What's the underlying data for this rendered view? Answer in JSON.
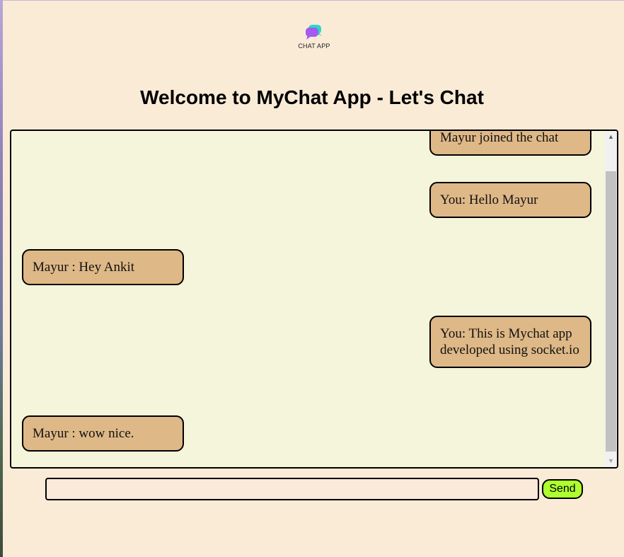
{
  "app": {
    "logo_text": "CHAT APP",
    "title": "Welcome to MyChat App - Let's Chat"
  },
  "messages": [
    {
      "side": "right",
      "text": "Mayur joined the chat"
    },
    {
      "side": "right",
      "text": "You: Hello Mayur"
    },
    {
      "side": "left",
      "text": "Mayur : Hey Ankit"
    },
    {
      "side": "right",
      "text": "You: This is Mychat app developed using socket.io"
    },
    {
      "side": "left",
      "text": "Mayur : wow nice."
    }
  ],
  "composer": {
    "input_value": "",
    "send_label": "Send"
  },
  "colors": {
    "page_bg": "#faebd7",
    "chat_bg": "#f5f5dc",
    "bubble_bg": "#deb887",
    "send_bg": "#adff2f"
  },
  "icons": {
    "logo": "chat-bubbles-icon",
    "scroll_up": "arrow-up-icon",
    "scroll_down": "arrow-down-icon"
  }
}
